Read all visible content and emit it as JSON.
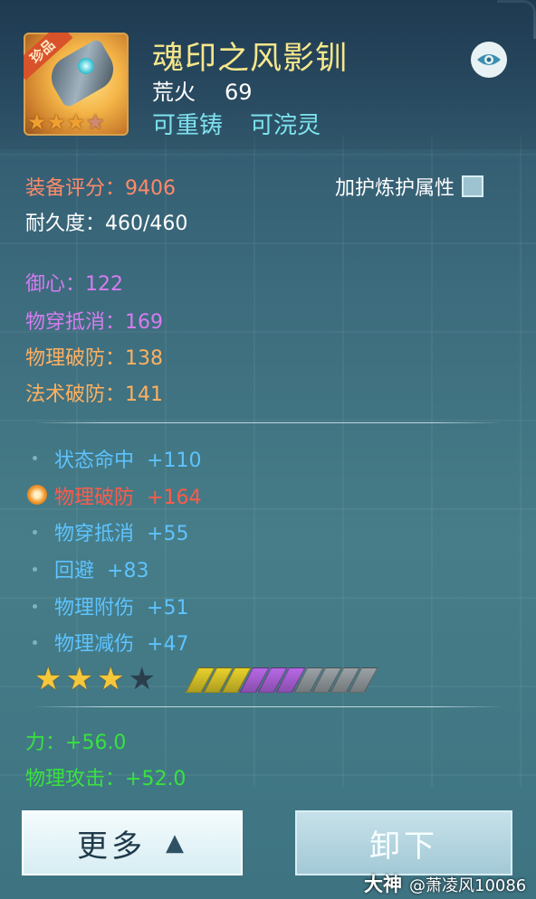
{
  "item": {
    "rarity_tag": "珍品",
    "name": "魂印之风影钏",
    "type": "荒火",
    "level": "69",
    "tag_reforge": "可重铸",
    "tag_refine": "可浣灵",
    "icon_stars": {
      "filled": 3,
      "total": 4
    }
  },
  "stats": {
    "score_label": "装备评分：",
    "score_value": "9406",
    "durability_label": "耐久度：",
    "durability_value": "460/460",
    "protect_label": "加护炼护属性"
  },
  "base_attrs": [
    {
      "label": "御心：",
      "value": "122"
    },
    {
      "label": "物穿抵消：",
      "value": "169"
    },
    {
      "label": "物理破防：",
      "value": "138"
    },
    {
      "label": "法术破防：",
      "value": "141"
    }
  ],
  "extra_attrs": [
    {
      "label": "状态命中",
      "value": "+110"
    },
    {
      "label": "物理破防",
      "value": "+164"
    },
    {
      "label": "物穿抵消",
      "value": "+55"
    },
    {
      "label": "回避",
      "value": "+83"
    },
    {
      "label": "物理附伤",
      "value": "+51"
    },
    {
      "label": "物理减伤",
      "value": "+47"
    }
  ],
  "enhance": {
    "stars_filled": 3,
    "stars_total": 4,
    "gems": [
      "yellow",
      "yellow",
      "yellow",
      "purple",
      "purple",
      "purple",
      "gray",
      "gray",
      "gray",
      "gray"
    ]
  },
  "bonus_attrs": [
    {
      "label": "力：",
      "value": "+56.0"
    },
    {
      "label": "物理攻击：",
      "value": "+52.0"
    }
  ],
  "buttons": {
    "more": "更多",
    "unequip": "卸下"
  },
  "watermark": {
    "brand": "大神",
    "handle": "@萧凌风10086"
  },
  "colors": {
    "name": "#f7e78a",
    "score": "#ff8a6a",
    "purple_attr": "#d67cf0",
    "orange_attr": "#ffb060",
    "blue_attr": "#5ec3ff",
    "red_attr": "#ff5a4a",
    "green_attr": "#39e23e",
    "gem_yellow": "#e8d12c",
    "gem_purple": "#b768e6",
    "gem_gray": "#9aa2a6"
  }
}
